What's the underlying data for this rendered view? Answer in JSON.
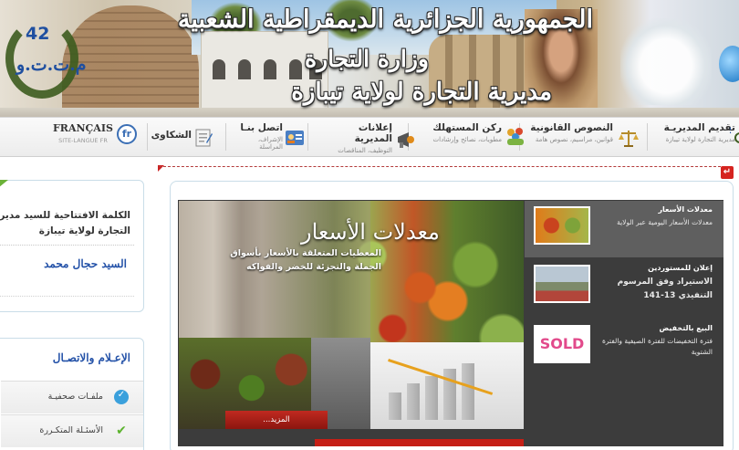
{
  "header": {
    "logo_number": "42",
    "logo_text": "م.ت.ت.و",
    "line1": "الجمهورية الجزائرية الديمقراطية الشعبية",
    "line2": "وزارة التجارة",
    "line3": "مديرية التجارة لولاية تيبازة"
  },
  "nav": {
    "items": [
      {
        "title": "تقديم المديريـة",
        "subtitle": "مديرية التجارة لولاية تيبازة",
        "icon": "presentation-icon"
      },
      {
        "title": "النصوص القانونية",
        "subtitle": "قوانين، مراسيم، نصوص هامة",
        "icon": "scales-icon"
      },
      {
        "title": "ركن المستهلك",
        "subtitle": "مطويات، نصائح وإرشادات",
        "icon": "people-icon"
      },
      {
        "title": "إعلانات المديرية",
        "subtitle": "التوظيف، المناقصات",
        "icon": "megaphone-icon"
      },
      {
        "title": "اتصل بنـا",
        "subtitle": "الإشراف، المراسلة",
        "icon": "contact-card-icon"
      },
      {
        "title": "الشكاوى",
        "subtitle": "",
        "icon": "notepad-icon"
      }
    ],
    "french": {
      "title": "FRANÇAIS",
      "subtitle": "SITE-LANGUE FR",
      "badge": "fr"
    }
  },
  "sidebar": {
    "welcome_text": "الكلمة الافتتاحية للسيد مدير التجارة لولاية تيبازة",
    "director_name": "السيد حجال محمد",
    "media_title": "الإعـلام والاتصـال",
    "media_items": [
      {
        "label": "ملفـات صحفيـة",
        "icon": "check-blue-icon",
        "color": "#3aa0dc"
      },
      {
        "label": "الأسئـلة المتكـررة",
        "icon": "check-green-icon",
        "color": "#5cb32e"
      }
    ]
  },
  "slider": {
    "title": "معدلات الأسعار",
    "description": "المعطيات المتعلقة بالأسعار بأسواق الجملة والتجزئة للخضر والفواكه",
    "more_label": "المزيد...",
    "thumbs": [
      {
        "title": "معدلات الأسعار",
        "desc": "معدلات الأسعار اليومية عبر الولاية",
        "active": true
      },
      {
        "title": "إعلان للمستوردين",
        "desc": "الاستيراد وفق المرسوم التنفيذي 13-141",
        "active": false
      },
      {
        "title": "البيع بالتخفيض",
        "desc": "فترة التخفيضات للفترة الصيفية والفترة الشتوية",
        "active": false
      }
    ],
    "thumb_badge": "SOLD"
  },
  "colors": {
    "accent_blue": "#2452a8",
    "accent_red": "#c51f16",
    "accent_green": "#5cb32e"
  }
}
